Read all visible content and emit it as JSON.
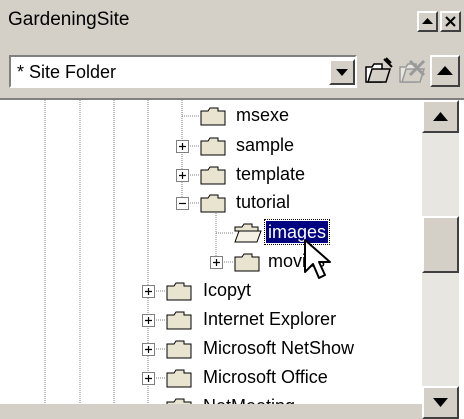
{
  "window": {
    "title": "GardeningSite"
  },
  "toolbar": {
    "folder_select_value": "* Site Folder"
  },
  "icons": {
    "dropdown": "chevron-down-icon",
    "new_folder": "new-folder-icon",
    "delete": "delete-folder-icon",
    "scroll_up": "arrow-up-icon",
    "scroll_down": "arrow-down-icon",
    "title_up": "arrow-up-icon",
    "title_close": "close-icon",
    "cursor": "pointer-icon"
  },
  "tree": {
    "items": [
      {
        "label": "msexe",
        "expander": "none"
      },
      {
        "label": "sample",
        "expander": "plus"
      },
      {
        "label": "template",
        "expander": "plus"
      },
      {
        "label": "tutorial",
        "expander": "minus"
      },
      {
        "label": "images",
        "expander": "none",
        "selected": true
      },
      {
        "label": "movies",
        "expander": "plus"
      },
      {
        "label": "Icopyt",
        "expander": "plus"
      },
      {
        "label": "Internet Explorer",
        "expander": "plus"
      },
      {
        "label": "Microsoft NetShow",
        "expander": "plus"
      },
      {
        "label": "Microsoft Office",
        "expander": "plus"
      },
      {
        "label": "NetMeeting",
        "expander": "none"
      }
    ]
  },
  "colors": {
    "chrome": "#d4d0c8",
    "selection": "#000080",
    "tree_line": "#808080"
  }
}
